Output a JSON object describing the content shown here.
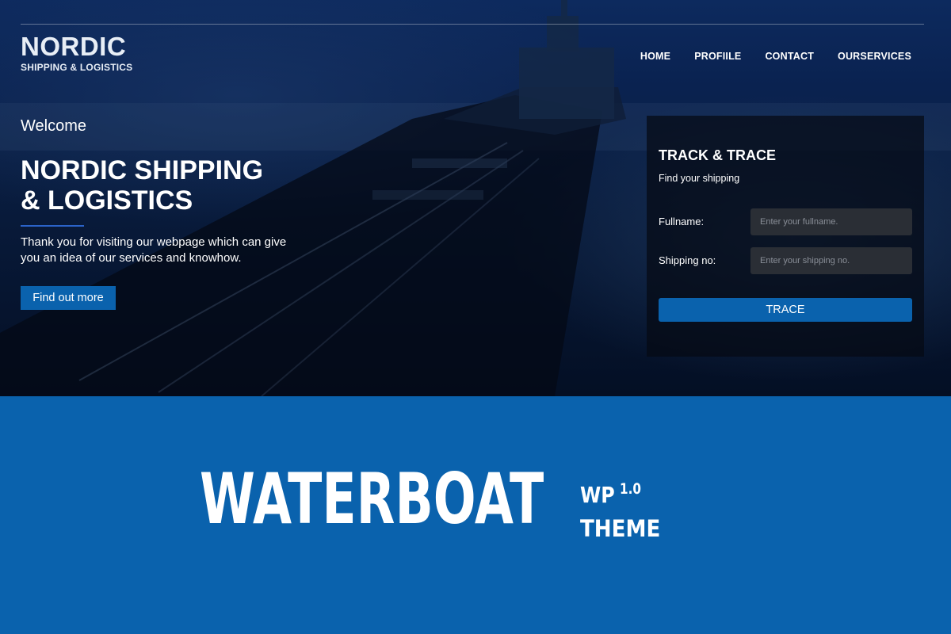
{
  "brand": {
    "title": "NORDIC",
    "subtitle": "SHIPPING & LOGISTICS"
  },
  "nav": {
    "items": [
      {
        "label": "HOME"
      },
      {
        "label": "PROFIILE"
      },
      {
        "label": "CONTACT"
      },
      {
        "label": "OURSERVICES"
      }
    ]
  },
  "hero": {
    "welcome": "Welcome",
    "headline_line1": "NORDIC SHIPPING",
    "headline_line2": "& LOGISTICS",
    "intro": "Thank you for visiting our webpage which can give you an idea of our services and knowhow.",
    "cta_label": "Find out more"
  },
  "track": {
    "title": "TRACK & TRACE",
    "subtitle": "Find your shipping",
    "fullname_label": "Fullname:",
    "fullname_placeholder": "Enter your fullname.",
    "shipping_label": "Shipping no:",
    "shipping_placeholder": "Enter your shipping no.",
    "trace_label": "TRACE"
  },
  "banner": {
    "name": "WATERBOAT",
    "wp": "WP",
    "version": "1.0",
    "theme": "THEME"
  },
  "colors": {
    "accent": "#0a62ad",
    "hero_dark": "#061530"
  }
}
